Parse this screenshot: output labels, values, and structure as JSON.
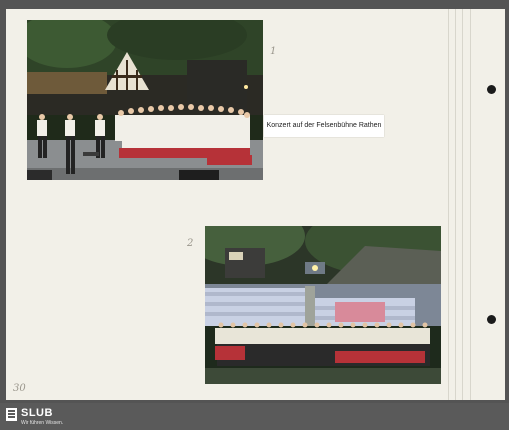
{
  "page": {
    "number_label": "30",
    "background": "#f2f0e8"
  },
  "photos": [
    {
      "label": "1",
      "subject": "choir-stage-photo"
    },
    {
      "label": "2",
      "subject": "open-air-theater-audience-photo"
    }
  ],
  "caption": {
    "text": "Konzert auf der Felsenbühne Rathen"
  },
  "footer": {
    "logo_name": "SLUB",
    "logo_tagline": "Wir führen Wissen.",
    "background": "#5a5a5a"
  }
}
